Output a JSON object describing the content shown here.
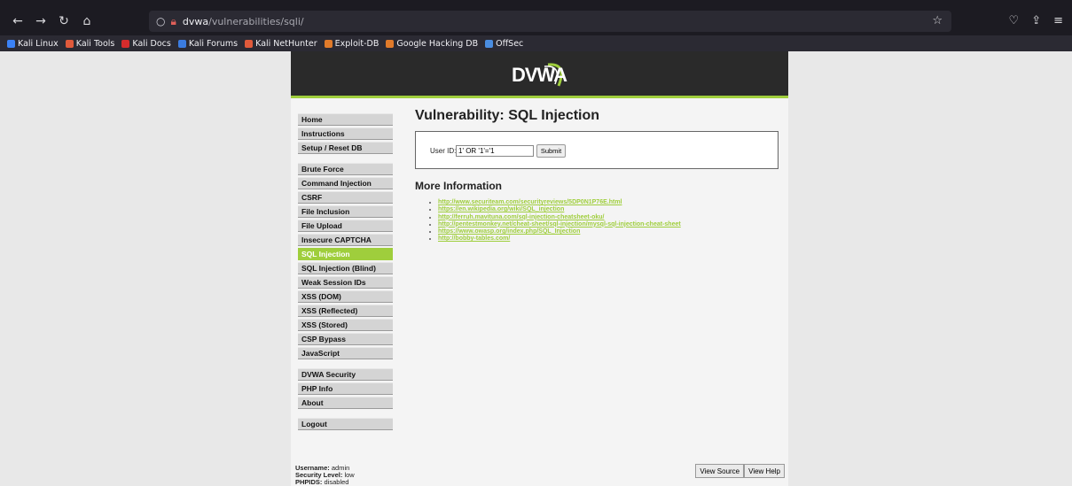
{
  "browser": {
    "url_host": "dvwa",
    "url_path": "/vulnerabilities/sqli/",
    "bookmarks": [
      {
        "label": "Kali Linux",
        "color": "#3b82f6"
      },
      {
        "label": "Kali Tools",
        "color": "#e05a3b"
      },
      {
        "label": "Kali Docs",
        "color": "#d62c2c"
      },
      {
        "label": "Kali Forums",
        "color": "#3b7ce0"
      },
      {
        "label": "Kali NetHunter",
        "color": "#e05a3b"
      },
      {
        "label": "Exploit-DB",
        "color": "#e07a2a"
      },
      {
        "label": "Google Hacking DB",
        "color": "#e07a2a"
      },
      {
        "label": "OffSec",
        "color": "#4a8de0"
      }
    ]
  },
  "dvwa": {
    "logo": "DVWA",
    "accent": "#9fce3c",
    "menu": [
      {
        "label": "Home"
      },
      {
        "label": "Instructions"
      },
      {
        "label": "Setup / Reset DB"
      },
      {
        "label": "Brute Force"
      },
      {
        "label": "Command Injection"
      },
      {
        "label": "CSRF"
      },
      {
        "label": "File Inclusion"
      },
      {
        "label": "File Upload"
      },
      {
        "label": "Insecure CAPTCHA"
      },
      {
        "label": "SQL Injection"
      },
      {
        "label": "SQL Injection (Blind)"
      },
      {
        "label": "Weak Session IDs"
      },
      {
        "label": "XSS (DOM)"
      },
      {
        "label": "XSS (Reflected)"
      },
      {
        "label": "XSS (Stored)"
      },
      {
        "label": "CSP Bypass"
      },
      {
        "label": "JavaScript"
      },
      {
        "label": "DVWA Security"
      },
      {
        "label": "PHP Info"
      },
      {
        "label": "About"
      },
      {
        "label": "Logout"
      }
    ],
    "page_title": "Vulnerability: SQL Injection",
    "form": {
      "label": "User ID:",
      "value": "1' OR '1'='1",
      "submit": "Submit"
    },
    "more_info_title": "More Information",
    "links": [
      "http://www.securiteam.com/securityreviews/5DP0N1P76E.html",
      "https://en.wikipedia.org/wiki/SQL_injection",
      "http://ferruh.mavituna.com/sql-injection-cheatsheet-oku/",
      "http://pentestmonkey.net/cheat-sheet/sql-injection/mysql-sql-injection-cheat-sheet",
      "https://www.owasp.org/index.php/SQL_Injection",
      "http://bobby-tables.com/"
    ],
    "user": {
      "username_label": "Username:",
      "username": "admin",
      "security_label": "Security Level:",
      "security": "low",
      "phpids_label": "PHPIDS:",
      "phpids": "disabled"
    },
    "view_source": "View Source",
    "view_help": "View Help"
  }
}
